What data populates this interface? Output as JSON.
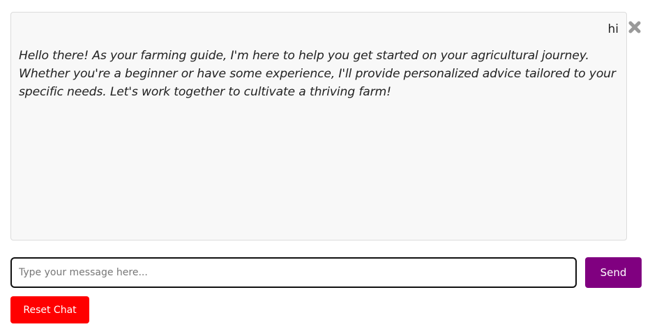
{
  "chat": {
    "user_message": "hi",
    "bot_message": "Hello there! As your farming guide, I'm here to help you get started on your agricultural journey. Whether you're a beginner or have some experience, I'll provide personalized advice tailored to your specific needs. Let's work together to cultivate a thriving farm!"
  },
  "composer": {
    "placeholder": "Type your message here...",
    "value": "",
    "send_label": "Send"
  },
  "actions": {
    "reset_label": "Reset Chat"
  },
  "icons": {
    "close": "close-icon"
  },
  "colors": {
    "send_bg": "#800080",
    "reset_bg": "#ff0000",
    "chat_bg": "#f8f8f8"
  }
}
